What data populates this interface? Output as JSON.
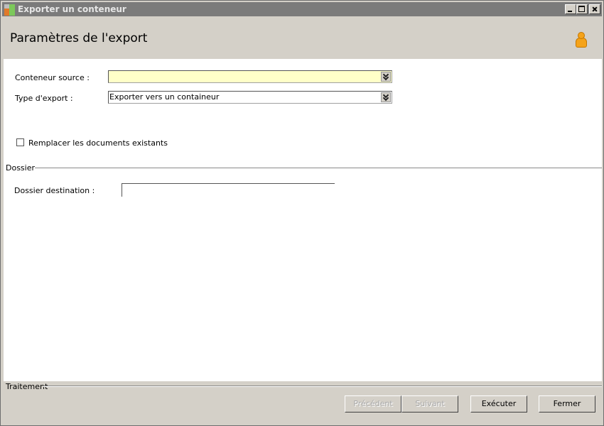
{
  "window": {
    "title": "Exporter un conteneur"
  },
  "header": {
    "title": "Paramètres de l'export"
  },
  "form": {
    "source_label": "Conteneur source :",
    "source_value": "",
    "type_label": "Type d'export :",
    "type_value": "Exporter vers un containeur",
    "replace_label": "Remplacer les documents existants",
    "replace_checked": false
  },
  "folder_group": {
    "title": "Dossier",
    "dest_label": "Dossier destination :",
    "dest_value": ""
  },
  "footer": {
    "title": "Traitement",
    "prev_label": "Précédent",
    "next_label": "Suivant",
    "execute_label": "Exécuter",
    "close_label": "Fermer"
  },
  "colors": {
    "required_field_bg": "#ffffc8",
    "titlebar_bg": "#7b7b7b",
    "dialog_bg": "#d4d0c8"
  },
  "icons": {
    "app": "app-icon",
    "user": "user-icon"
  }
}
